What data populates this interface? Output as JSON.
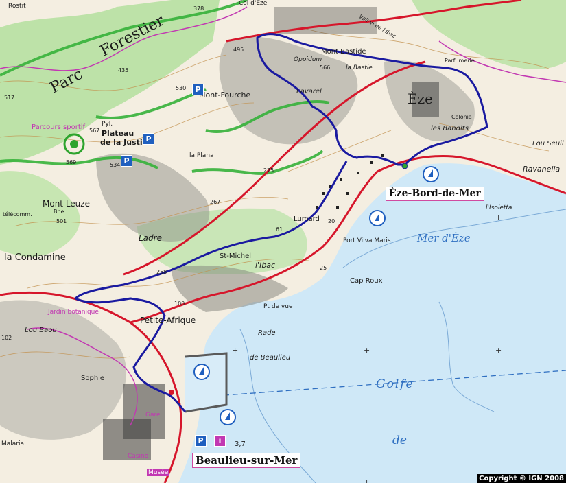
{
  "map": {
    "copyright": "Copyright © IGN 2008",
    "sea_labels": [
      "Mer d'Èze",
      "Golfe",
      "de"
    ],
    "towns": [
      "Èze-Bord-de-Mer",
      "Beaulieu-sur-Mer"
    ],
    "places": {
      "parc": "Parc",
      "forestier": "Forestier",
      "mont_fourche": "Mont-Fourche",
      "plateau": "Plateau",
      "justice": "de la Justice",
      "pyl": "Pyl.",
      "parcours": "Parcours sportif",
      "mont_leuze": "Mont Leuze",
      "condamine": "la Condamine",
      "eze": "Èze",
      "mont_bastide": "Mont Bastide",
      "oppidum": "Oppidum",
      "lavarel": "Lavarel",
      "la_plana": "la Plana",
      "ladre": "Ladre",
      "lumard": "Lumard",
      "st_michel": "St-Michel",
      "ibac": "l'Ibac",
      "petite_afrique": "Petite-Afrique",
      "cap_roux": "Cap Roux",
      "port_viva": "Port Vilva Maris",
      "isoletta": "l'Isoletta",
      "ravanella": "Ravanella",
      "rade": "Rade",
      "beaulieu_de": "de Beaulieu",
      "pt_vue": "Pt de vue",
      "sophie": "Sophie",
      "malaria": "Malaria",
      "gare": "Gare",
      "musee": "Musée",
      "casino": "Casino",
      "rostit": "Rostit",
      "col_eze": "Col d'Èze",
      "jardin": "Jardin botanique",
      "cote_km": "3,7",
      "telecomm": "télécomm.",
      "bne": "Bne",
      "parfumerie": "Parfumerie",
      "colonia": "Colonia",
      "les_bandits": "les Bandits",
      "lou_baou": "Lou Baou",
      "lou_seuil": "Lou Seuil",
      "la_bastie": "la Bastie",
      "vallon": "Vallon de l'Ibac"
    },
    "spot_heights": [
      "378",
      "495",
      "566",
      "530",
      "517",
      "435",
      "567",
      "534",
      "569",
      "501",
      "275",
      "267",
      "258",
      "102",
      "100",
      "61",
      "20",
      "25"
    ],
    "info_icon": "i",
    "parking_label": "P",
    "colors": {
      "sea": "#cfe8f7",
      "land": "#f6f1e7",
      "forest": "#b8dea4",
      "relief": "#8b8b87",
      "route": "#1a1aa0",
      "road": "#d6162b",
      "trail": "#2ea42e",
      "border": "#c238b2",
      "contour": "#c2904c"
    }
  }
}
